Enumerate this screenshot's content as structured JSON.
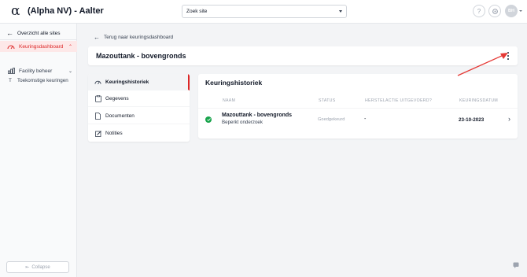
{
  "header": {
    "logo_glyph": "α",
    "title": "(Alpha NV) - Aalter",
    "site_select_value": "Zoek site",
    "help_icon": "?",
    "avatar_initials": "BH"
  },
  "sidebar": {
    "back_label": "Overzicht alle sites",
    "items": [
      {
        "label": "Keuringsdashboard",
        "icon": "gauge-icon",
        "active": true
      },
      {
        "label": "Toekomstige keuringen",
        "icon": "t-icon",
        "active": false
      },
      {
        "label": "Facility beheer",
        "icon": "chart-icon",
        "active": false
      }
    ],
    "sub_glyph": "T",
    "collapse_label": "Collapse"
  },
  "main": {
    "back_link": "Terug naar keuringsdashboard",
    "title": "Mazouttank - bovengronds",
    "tabs": [
      {
        "label": "Keuringshistoriek",
        "icon": "gauge-icon",
        "active": true
      },
      {
        "label": "Gegevens",
        "icon": "clipboard-icon",
        "active": false
      },
      {
        "label": "Documenten",
        "icon": "document-icon",
        "active": false
      },
      {
        "label": "Notities",
        "icon": "edit-icon",
        "active": false
      }
    ],
    "history": {
      "title": "Keuringshistoriek",
      "columns": [
        "NAAM",
        "STATUS",
        "HERSTELACTIE UITGEVOERD?",
        "KEURINGSDATUM"
      ],
      "rows": [
        {
          "name": "Mazouttank - bovengronds",
          "subtitle": "Beperkt onderzoek",
          "status": "Goedgekeurd",
          "herstelactie": "-",
          "date": "23-10-2023"
        }
      ]
    }
  },
  "colors": {
    "accent": "#dc2626",
    "success": "#16a34a",
    "annotation_arrow": "#e53935"
  }
}
